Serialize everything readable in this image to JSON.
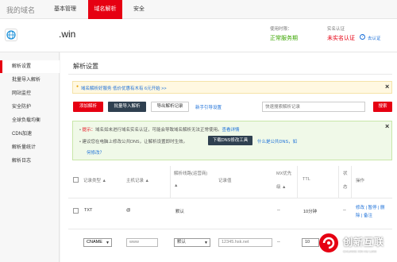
{
  "topnav": {
    "brand": "我的域名",
    "tabs": [
      {
        "label": "基本管理"
      },
      {
        "label": "域名解析",
        "active": true
      },
      {
        "label": "安全"
      }
    ]
  },
  "domain": {
    "name": ".win",
    "service_label": "使用时限：",
    "service_value": "正常服务期",
    "auth_label": "实名认证",
    "auth_value": "未实名认证",
    "auth_link": "去认证"
  },
  "sidebar": {
    "items": [
      {
        "label": "解析设置",
        "active": true
      },
      {
        "label": "批量导入解析"
      },
      {
        "label": "网站监控"
      },
      {
        "label": "安全防护"
      },
      {
        "label": "全球负载均衡"
      },
      {
        "label": "CDN加速"
      },
      {
        "label": "解析量统计"
      },
      {
        "label": "解析日志"
      }
    ]
  },
  "main": {
    "title": "解析设置",
    "notice": "域名解析好服务 低价优惠有木有 6元开始 >>",
    "toolbar": {
      "add": "添加解析",
      "batch_import": "批量导入解析",
      "export": "导出解析记录",
      "guide": "新手引导设置",
      "search_placeholder": "快速搜索解析记录",
      "search_btn": "搜索"
    },
    "tip": {
      "line1_prefix": "提示：",
      "line1_text": "域名如未进行域名实名认证，可能会导致域名解析无法正常使用。",
      "line1_link": "查看详情",
      "line2_text": "建议您在电脑上修改公共DNS，让解析设置即时生效。",
      "line2_btn": "下载DNS修改工具",
      "line2_link": "什么是公共DNS，如",
      "line3_link": "何修改？"
    },
    "table": {
      "headers": {
        "type": "记录类型",
        "host": "主机记录",
        "line": "解析线路(运营商)",
        "value": "记录值",
        "mx": "MX优先",
        "mx2": "级",
        "ttl": "TTL",
        "status": "状",
        "status2": "态",
        "ops": "操作"
      },
      "rows": [
        {
          "type": "TXT",
          "host": "@",
          "line": "默认",
          "value": "",
          "mx": "--",
          "ttl": "10分钟",
          "status": "--",
          "ops1": "修改 | 暂停 | 删",
          "ops2": "除 | 备注"
        }
      ],
      "edit_row": {
        "type": "CNAME",
        "host": "www",
        "line": "默认",
        "value": "12345.hsk.net",
        "mx": "--",
        "ttl": "10"
      }
    }
  },
  "watermark": {
    "text": "创新互联",
    "sub": "CHUANG XIN HU LIAN"
  }
}
